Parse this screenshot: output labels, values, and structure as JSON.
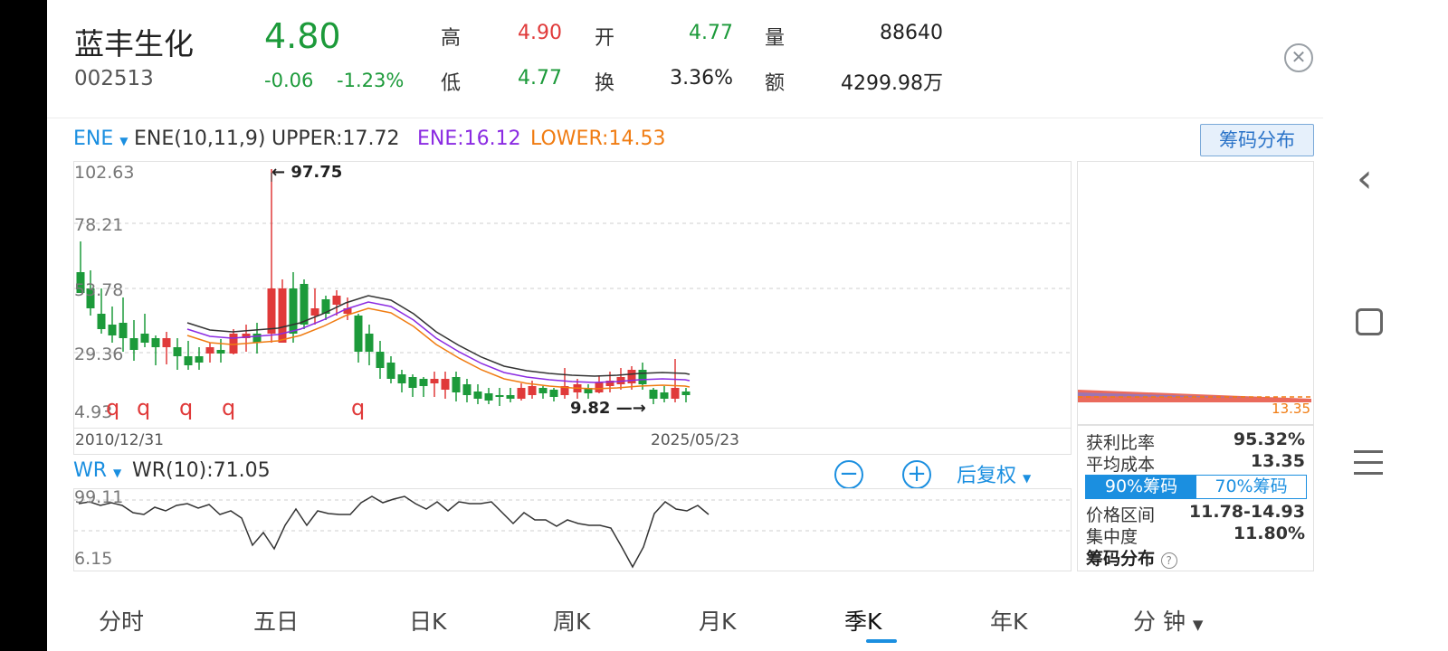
{
  "header": {
    "stock_name": "蓝丰生化",
    "stock_code": "002513",
    "price": "4.80",
    "change": "-0.06",
    "change_pct": "-1.23%",
    "stats": {
      "high_label": "高",
      "high_value": "4.90",
      "open_label": "开",
      "open_value": "4.77",
      "volume_label": "量",
      "volume_value": "88640",
      "low_label": "低",
      "low_value": "4.77",
      "turnover_label": "换",
      "turnover_value": "3.36%",
      "amount_label": "额",
      "amount_value": "4299.98万"
    },
    "close_icon": "close-circle-icon"
  },
  "indicator": {
    "name": "ENE",
    "params": "ENE(10,11,9)",
    "upper": "UPPER:17.72",
    "ene": "ENE:16.12",
    "lower": "LOWER:14.53",
    "chip_button": "筹码分布"
  },
  "kline": {
    "y_ticks": [
      "102.63",
      "78.21",
      "53.78",
      "29.36",
      "4.93"
    ],
    "max_annotation": "97.75",
    "min_annotation": "9.82",
    "start_date": "2010/12/31",
    "end_date": "2025/05/23",
    "q_markers": [
      "q",
      "q",
      "q",
      "q",
      "q"
    ]
  },
  "wr": {
    "name": "WR",
    "value": "WR(10):71.05",
    "y_ticks": [
      "99.11",
      "6.15"
    ],
    "zoom_out_icon": "minus-circle-icon",
    "zoom_in_icon": "plus-circle-icon",
    "adjust": "后复权"
  },
  "chip": {
    "price_marker": "13.35",
    "profit_label": "获利比率",
    "profit_value": "95.32%",
    "avgcost_label": "平均成本",
    "avgcost_value": "13.35",
    "tab_90": "90%筹码",
    "tab_70": "70%筹码",
    "range_label": "价格区间",
    "range_value": "11.78-14.93",
    "conc_label": "集中度",
    "conc_value": "11.80%",
    "footer": "筹码分布"
  },
  "bottom_nav": [
    "分时",
    "五日",
    "日K",
    "周K",
    "月K",
    "季K",
    "年K",
    "分 钟"
  ],
  "active_tab": "季K",
  "colors": {
    "up": "#e03a3a",
    "down": "#1c9a3a",
    "accent": "#1b8fe0",
    "upper": "#333333",
    "ene": "#8b2be2",
    "lower": "#f07c12"
  }
}
